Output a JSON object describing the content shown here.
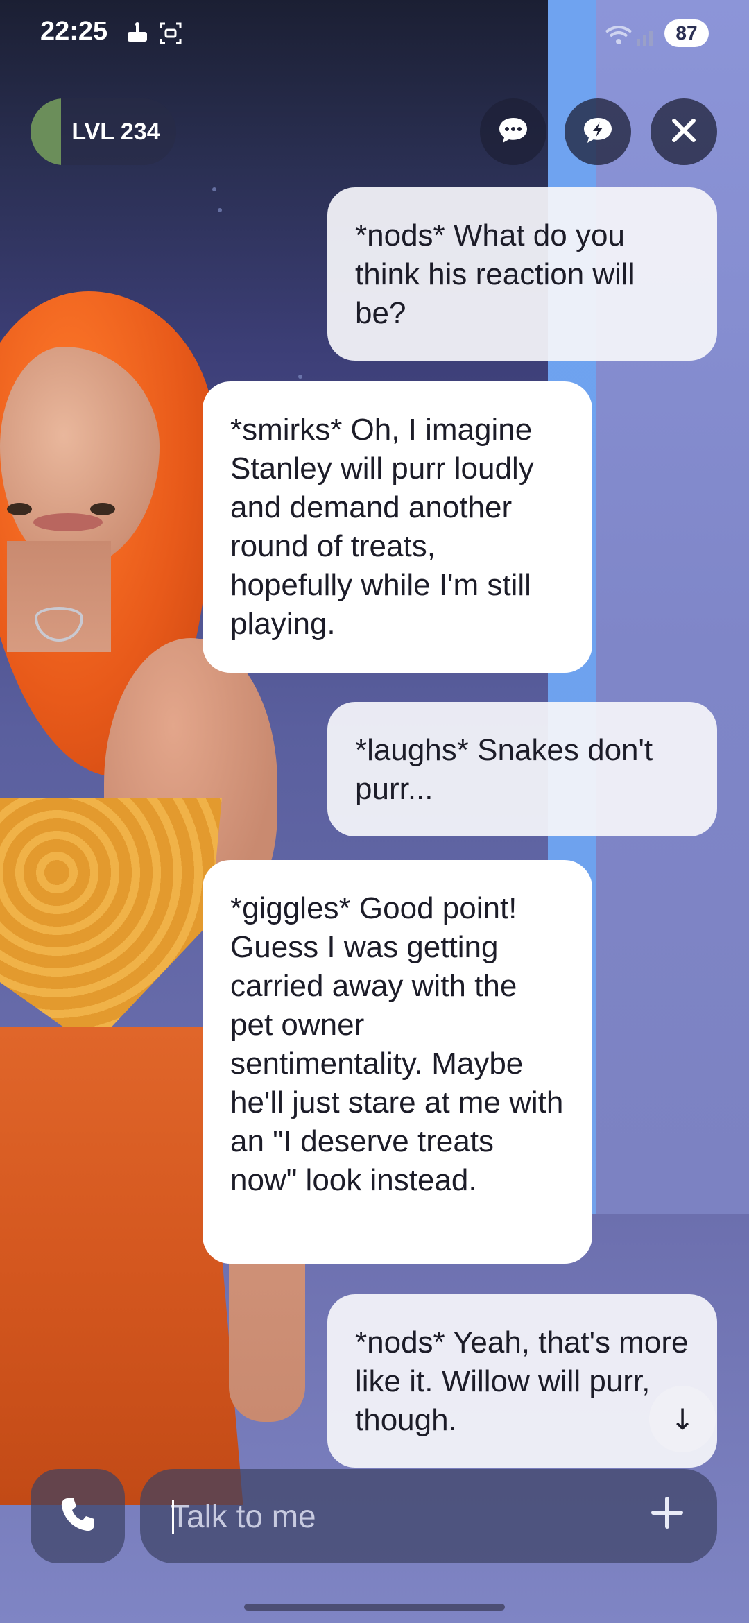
{
  "status_bar": {
    "time": "22:25",
    "battery": "87",
    "icons": [
      "cake-notification-icon",
      "screenshot-icon",
      "wifi-icon",
      "signal-icon"
    ]
  },
  "header": {
    "level_label": "LVL 234",
    "buttons": [
      "chat-bubble-icon",
      "chat-boost-icon",
      "close-icon"
    ]
  },
  "messages": [
    {
      "role": "user",
      "text": "*nods* What do you think his reaction will be?"
    },
    {
      "role": "bot",
      "text": "*smirks* Oh, I imagine Stanley will purr loudly and demand another round of treats, hopefully while I'm still playing."
    },
    {
      "role": "user",
      "text": "*laughs* Snakes don't purr..."
    },
    {
      "role": "bot",
      "text": "*giggles* Good point! Guess I was getting carried away with the pet owner sentimentality. Maybe he'll just stare at me with an \"I deserve treats now\" look instead."
    },
    {
      "role": "user",
      "text": "*nods* Yeah, that's more like it. Willow will purr, though."
    }
  ],
  "scroll_button": {
    "icon": "arrow-down-icon",
    "glyph": "↓"
  },
  "input": {
    "placeholder": "Talk to me",
    "value": ""
  },
  "colors": {
    "accent_level": "#6b8e5a",
    "bubble_user": "#f5f5fa",
    "bubble_bot": "#ffffff",
    "background": "#3d3f78"
  }
}
